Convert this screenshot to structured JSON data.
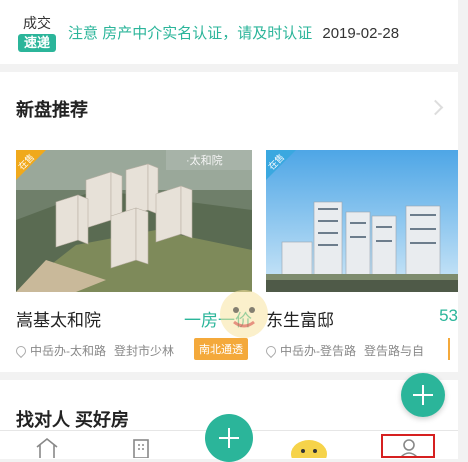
{
  "news": {
    "badge_top": "成交",
    "badge_bottom": "速递",
    "tag": "注意",
    "title": "房产中介实名认证，请及时认证",
    "date": "2019-02-28"
  },
  "new_projects": {
    "title": "新盘推荐",
    "cards": [
      {
        "corner": "在售",
        "image_caption": "·太和院",
        "name": "嵩基太和院",
        "price": "一房一价",
        "district": "中岳办-太和路",
        "area": "登封市少林",
        "feature": "南北通透"
      },
      {
        "corner": "在售",
        "name": "东生富邸",
        "price": "53",
        "district": "中岳办-登告路",
        "area": "登告路与自"
      }
    ]
  },
  "find_agent": {
    "title": "找对人 买好房"
  },
  "tabbar": {
    "items": [
      "home-icon",
      "building-icon",
      "publish-plus-icon",
      "mascot-icon",
      "profile-icon"
    ]
  },
  "colors": {
    "accent": "#2bb59a",
    "corner_sale": "#f0a91c",
    "corner_sale_blue": "#3aa8e0",
    "feature_tag": "#f4a93b",
    "highlight": "#d62020"
  }
}
